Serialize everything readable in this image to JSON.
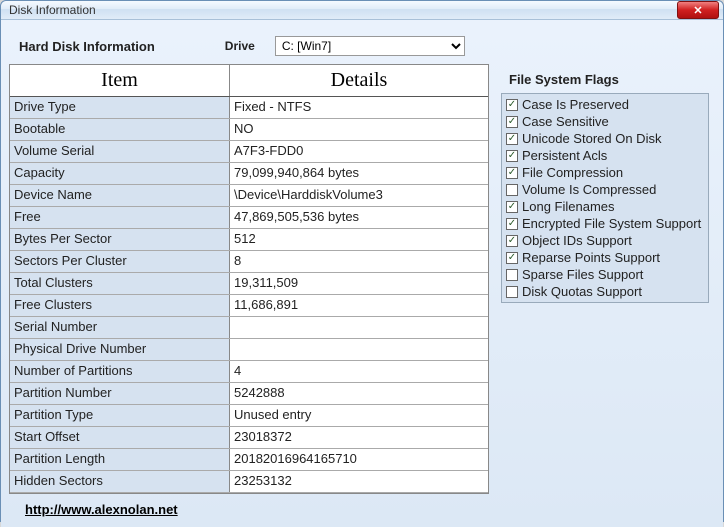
{
  "window": {
    "title": "Disk Information"
  },
  "header": {
    "label": "Hard Disk Information",
    "drive_label": "Drive",
    "drive_value": "C: [Win7]"
  },
  "table": {
    "col_item": "Item",
    "col_details": "Details",
    "rows": [
      {
        "item": "Drive Type",
        "details": "Fixed - NTFS"
      },
      {
        "item": "Bootable",
        "details": "NO"
      },
      {
        "item": "Volume Serial",
        "details": "A7F3-FDD0"
      },
      {
        "item": "Capacity",
        "details": "79,099,940,864 bytes"
      },
      {
        "item": "Device Name",
        "details": "\\Device\\HarddiskVolume3"
      },
      {
        "item": "Free",
        "details": "47,869,505,536 bytes"
      },
      {
        "item": "Bytes Per Sector",
        "details": "512"
      },
      {
        "item": "Sectors Per Cluster",
        "details": "8"
      },
      {
        "item": "Total Clusters",
        "details": "19,311,509"
      },
      {
        "item": "Free Clusters",
        "details": "11,686,891"
      },
      {
        "item": "Serial Number",
        "details": ""
      },
      {
        "item": "Physical Drive Number",
        "details": ""
      },
      {
        "item": "Number of Partitions",
        "details": "4"
      },
      {
        "item": "Partition Number",
        "details": "5242888"
      },
      {
        "item": "Partition Type",
        "details": "Unused entry"
      },
      {
        "item": "Start Offset",
        "details": "23018372"
      },
      {
        "item": "Partition Length",
        "details": "20182016964165710"
      },
      {
        "item": "Hidden Sectors",
        "details": "23253132"
      }
    ]
  },
  "flags": {
    "title": "File System Flags",
    "items": [
      {
        "label": "Case Is Preserved",
        "checked": true
      },
      {
        "label": "Case Sensitive",
        "checked": true
      },
      {
        "label": "Unicode Stored On Disk",
        "checked": true
      },
      {
        "label": "Persistent Acls",
        "checked": true
      },
      {
        "label": "File Compression",
        "checked": true
      },
      {
        "label": "Volume Is Compressed",
        "checked": false
      },
      {
        "label": "Long Filenames",
        "checked": true
      },
      {
        "label": "Encrypted File System Support",
        "checked": true
      },
      {
        "label": "Object IDs Support",
        "checked": true
      },
      {
        "label": "Reparse Points Support",
        "checked": true
      },
      {
        "label": "Sparse Files Support",
        "checked": false
      },
      {
        "label": "Disk Quotas Support",
        "checked": false
      }
    ]
  },
  "footer": {
    "link_text": "http://www.alexnolan.net"
  }
}
